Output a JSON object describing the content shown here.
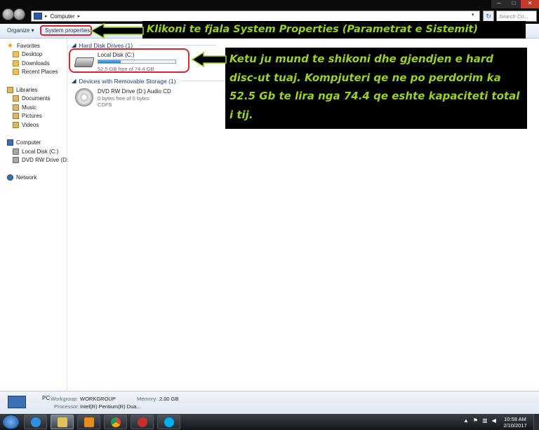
{
  "address": {
    "crumb": "Computer",
    "search_placeholder": "Search Co..."
  },
  "window": {
    "minimize": "─",
    "maximize": "□",
    "close": "✕"
  },
  "commands": {
    "organize": "Organize ▾",
    "system_properties": "System properties"
  },
  "sidebar": {
    "favorites": {
      "label": "Favorites",
      "items": [
        "Desktop",
        "Downloads",
        "Recent Places"
      ]
    },
    "libraries": {
      "label": "Libraries",
      "items": [
        "Documents",
        "Music",
        "Pictures",
        "Videos"
      ]
    },
    "computer": {
      "label": "Computer",
      "items": [
        "Local Disk (C:)",
        "DVD RW Drive (D:) A"
      ]
    },
    "network": {
      "label": "Network"
    }
  },
  "content": {
    "hard_disk_group": "Hard Disk Drives (1)",
    "local_disk": {
      "name": "Local Disk (C:)",
      "free_text": "52.5 GB free of 74.4 GB",
      "used_fraction": 0.294
    },
    "removable_group": "Devices with Removable Storage (1)",
    "dvd": {
      "name": "DVD RW Drive (D:) Audio CD",
      "free_text": "0 bytes free of 0 bytes",
      "fs": "CDFS"
    }
  },
  "annotations": {
    "note1": "Klikoni te fjala System Properties (Parametrat e Sistemit)",
    "note2": "Ketu ju mund te shikoni dhe gjendjen e hard disc-ut tuaj. Kompjuteri qe ne po perdorim ka 52.5 Gb te lira nga 74.4 qe eshte kapaciteti total i tij."
  },
  "details": {
    "name": "PC",
    "workgroup_label": "Workgroup:",
    "workgroup_value": "WORKGROUP",
    "memory_label": "Memory:",
    "memory_value": "2.00 GB",
    "processor_label": "Processor:",
    "processor_value": "Intel(R) Pentium(R) Dua..."
  },
  "taskbar": {
    "time": "10:59 AM",
    "date": "2/10/2017"
  },
  "colors": {
    "annotation_text": "#9bd11f",
    "highlight": "#d8262a",
    "accent": "#1e3f7a"
  }
}
